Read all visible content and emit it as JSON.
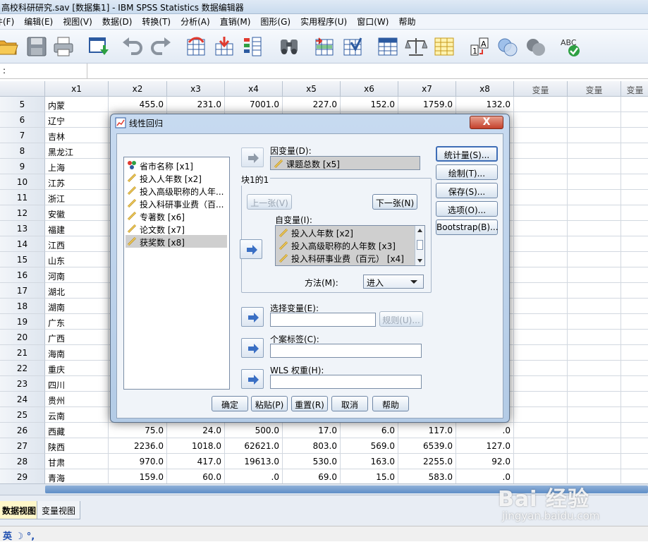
{
  "window": {
    "title": "高校科研研究.sav [数据集1] - IBM SPSS Statistics 数据编辑器"
  },
  "menu": [
    "件(F)",
    "编辑(E)",
    "视图(V)",
    "数据(D)",
    "转换(T)",
    "分析(A)",
    "直销(M)",
    "图形(G)",
    "实用程序(U)",
    "窗口(W)",
    "帮助"
  ],
  "toolbar_icons": [
    "open-folder",
    "save-disk",
    "print",
    "dialog-recall",
    "undo",
    "redo",
    "goto-case",
    "goto-variable",
    "variables",
    "find",
    "insert-cases",
    "insert-variable",
    "split-file",
    "weight-cases",
    "select-cases",
    "value-labels",
    "use-sets",
    "show-all",
    "spelling"
  ],
  "toolbar_spell_label": "ABC",
  "formula_bar": {
    "cell_ref": ":",
    "value": ""
  },
  "grid": {
    "columns": [
      "x1",
      "x2",
      "x3",
      "x4",
      "x5",
      "x6",
      "x7",
      "x8",
      "变量",
      "变量",
      "变量"
    ],
    "rows": [
      {
        "no": "5",
        "cells": [
          "内蒙",
          "455.0",
          "231.0",
          "7001.0",
          "227.0",
          "152.0",
          "1759.0",
          "132.0"
        ]
      },
      {
        "no": "6",
        "cells": [
          "辽宁",
          "",
          "",
          "",
          "",
          "",
          "",
          ""
        ]
      },
      {
        "no": "7",
        "cells": [
          "吉林",
          "",
          "",
          "",
          "",
          "",
          "",
          ""
        ]
      },
      {
        "no": "8",
        "cells": [
          "黑龙江",
          "",
          "",
          "",
          "",
          "",
          "",
          ""
        ]
      },
      {
        "no": "9",
        "cells": [
          "上海",
          "",
          "",
          "",
          "",
          "",
          "",
          ""
        ]
      },
      {
        "no": "10",
        "cells": [
          "江苏",
          "",
          "",
          "",
          "",
          "",
          "",
          ""
        ]
      },
      {
        "no": "11",
        "cells": [
          "浙江",
          "",
          "",
          "",
          "",
          "",
          "",
          ""
        ]
      },
      {
        "no": "12",
        "cells": [
          "安徽",
          "",
          "",
          "",
          "",
          "",
          "",
          ""
        ]
      },
      {
        "no": "13",
        "cells": [
          "福建",
          "",
          "",
          "",
          "",
          "",
          "",
          ""
        ]
      },
      {
        "no": "14",
        "cells": [
          "江西",
          "",
          "",
          "",
          "",
          "",
          "",
          ""
        ]
      },
      {
        "no": "15",
        "cells": [
          "山东",
          "",
          "",
          "",
          "",
          "",
          "",
          ""
        ]
      },
      {
        "no": "16",
        "cells": [
          "河南",
          "",
          "",
          "",
          "",
          "",
          "",
          ""
        ]
      },
      {
        "no": "17",
        "cells": [
          "湖北",
          "",
          "",
          "",
          "",
          "",
          "",
          ""
        ]
      },
      {
        "no": "18",
        "cells": [
          "湖南",
          "",
          "",
          "",
          "",
          "",
          "",
          ""
        ]
      },
      {
        "no": "19",
        "cells": [
          "广东",
          "",
          "",
          "",
          "",
          "",
          "",
          ""
        ]
      },
      {
        "no": "20",
        "cells": [
          "广西",
          "",
          "",
          "",
          "",
          "",
          "",
          ""
        ]
      },
      {
        "no": "21",
        "cells": [
          "海南",
          "",
          "",
          "",
          "",
          "",
          "",
          ""
        ]
      },
      {
        "no": "22",
        "cells": [
          "重庆",
          "",
          "",
          "",
          "",
          "",
          "",
          ""
        ]
      },
      {
        "no": "23",
        "cells": [
          "四川",
          "",
          "",
          "",
          "",
          "",
          "",
          ""
        ]
      },
      {
        "no": "24",
        "cells": [
          "贵州",
          "",
          "",
          "",
          "",
          "",
          "",
          ""
        ]
      },
      {
        "no": "25",
        "cells": [
          "云南",
          "",
          "",
          "",
          "",
          "",
          "",
          ""
        ]
      },
      {
        "no": "26",
        "cells": [
          "西藏",
          "75.0",
          "24.0",
          "500.0",
          "17.0",
          "6.0",
          "117.0",
          ".0"
        ]
      },
      {
        "no": "27",
        "cells": [
          "陕西",
          "2236.0",
          "1018.0",
          "62621.0",
          "803.0",
          "569.0",
          "6539.0",
          "127.0"
        ]
      },
      {
        "no": "28",
        "cells": [
          "甘肃",
          "970.0",
          "417.0",
          "19613.0",
          "530.0",
          "163.0",
          "2255.0",
          "92.0"
        ]
      },
      {
        "no": "29",
        "cells": [
          "青海",
          "159.0",
          "60.0",
          ".0",
          "69.0",
          "15.0",
          "583.0",
          ".0"
        ]
      }
    ]
  },
  "tabs": {
    "data_view": "数据视图",
    "variable_view": "变量视图"
  },
  "status": {
    "ime": "英"
  },
  "watermark": {
    "brand": "Bai 经验",
    "url": "jingyan.baidu.com"
  },
  "dialog": {
    "title": "线性回归",
    "close_label": "X",
    "variables": [
      {
        "label": "省市名称 [x1]",
        "type": "nominal"
      },
      {
        "label": "投入人年数 [x2]",
        "type": "scale"
      },
      {
        "label": "投入高级职称的人年...",
        "type": "scale"
      },
      {
        "label": "投入科研事业费（百...",
        "type": "scale"
      },
      {
        "label": "专著数 [x6]",
        "type": "scale"
      },
      {
        "label": "论文数 [x7]",
        "type": "scale"
      },
      {
        "label": "获奖数 [x8]",
        "type": "scale",
        "selected": true
      }
    ],
    "dependent_label": "因变量(D):",
    "dependent_value": "课题总数 [x5]",
    "block_label": "块1的1",
    "prev_button": "上一张(V)",
    "next_button": "下一张(N)",
    "independent_label": "自变量(I):",
    "independents": [
      "投入人年数 [x2]",
      "投入高级职称的人年数 [x3]",
      "投入科研事业费（百元） [x4]"
    ],
    "method_label": "方法(M):",
    "method_value": "进入",
    "selection_label": "选择变量(E):",
    "selection_value": "",
    "rule_button": "规则(U)...",
    "case_label": "个案标签(C):",
    "case_value": "",
    "wls_label": "WLS 权重(H):",
    "wls_value": "",
    "side_buttons": [
      "统计量(S)...",
      "绘制(T)...",
      "保存(S)...",
      "选项(O)...",
      "Bootstrap(B)..."
    ],
    "bottom_buttons": [
      "确定",
      "粘贴(P)",
      "重置(R)",
      "取消",
      "帮助"
    ]
  }
}
